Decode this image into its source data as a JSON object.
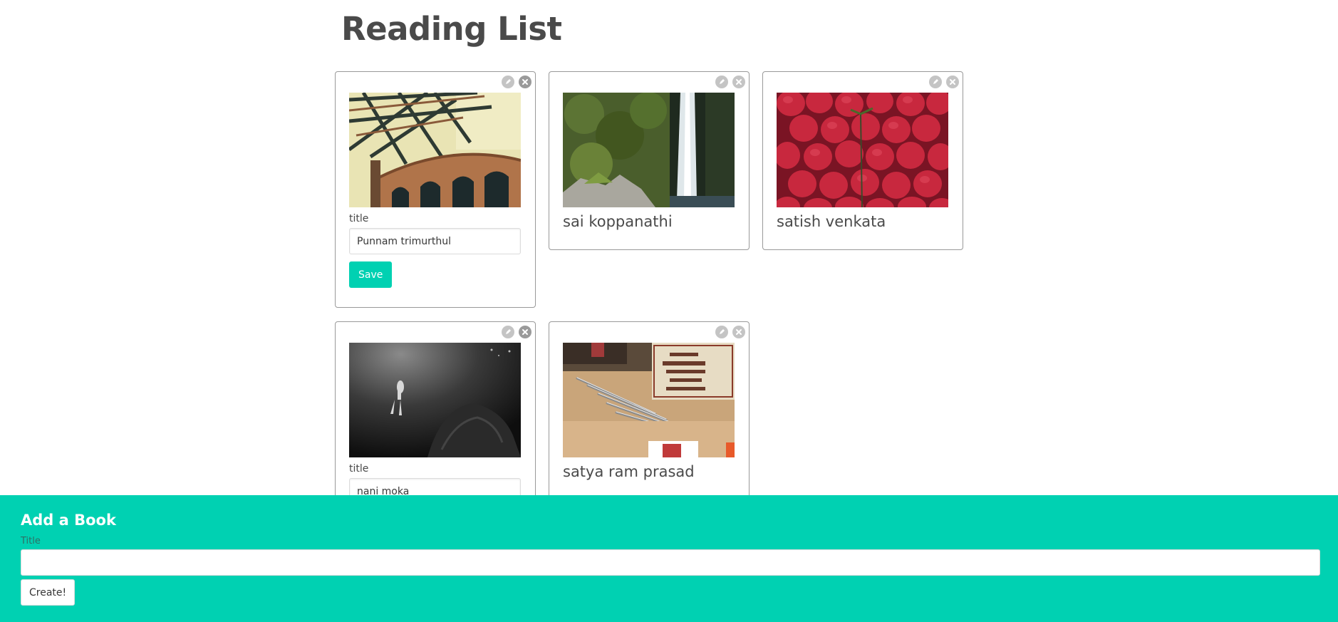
{
  "page": {
    "title": "Reading List"
  },
  "icons": {
    "edit": "pencil-icon",
    "delete": "close-icon"
  },
  "colors": {
    "accent": "#00d1b2",
    "heading": "#4a4a4a",
    "card_border": "#999999"
  },
  "books": [
    {
      "title": "Punnam trimurthul",
      "image": "bridge-photo",
      "mode": "edit",
      "field_label": "title",
      "save_label": "Save"
    },
    {
      "title": "sai koppanathi",
      "image": "waterfall-photo",
      "mode": "view"
    },
    {
      "title": "satish venkata",
      "image": "strawberries-photo",
      "mode": "view"
    },
    {
      "title": "nani moka",
      "image": "diver-photo",
      "mode": "edit",
      "field_label": "title"
    },
    {
      "title": "satya ram prasad",
      "image": "pencils-photo",
      "mode": "view"
    }
  ],
  "add_book": {
    "heading": "Add a Book",
    "title_label": "Title",
    "title_value": "",
    "submit_label": "Create!"
  }
}
